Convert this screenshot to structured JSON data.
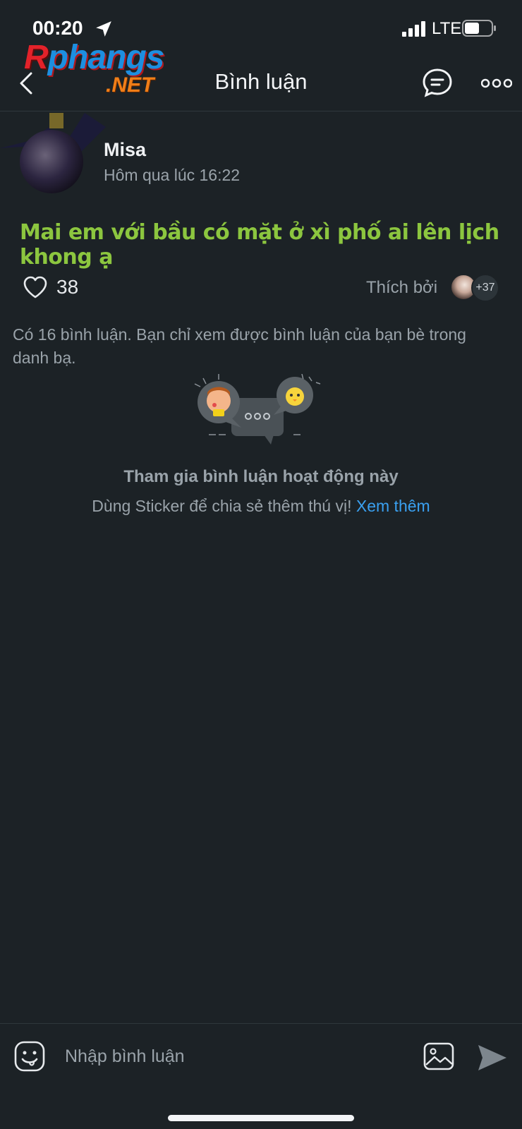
{
  "status_bar": {
    "time": "00:20",
    "network": "LTE",
    "icons": [
      "location-arrow-icon",
      "signal-bars-icon",
      "battery-icon"
    ]
  },
  "watermark": {
    "brand_letter": "R",
    "brand_rest": "phangs",
    "brand_sub": ".NET"
  },
  "header": {
    "title": "Bình luận",
    "icons": [
      "back-chevron-icon",
      "chat-bubble-icon",
      "more-dots-icon"
    ]
  },
  "post": {
    "author": "Misa",
    "time": "Hôm qua lúc 16:22",
    "text": "Mai em với bầu có mặt ở xì phố ai lên lịch khong ạ",
    "text_color": "#8cc63f",
    "likes": "38",
    "liked_by_label": "Thích bởi",
    "liked_by_more": "+37"
  },
  "comments": {
    "info": "Có 16 bình luận. Bạn chỉ xem được bình luận của bạn bè trong danh bạ.",
    "empty_title": "Tham gia bình luận hoạt động này",
    "empty_sub": "Dùng Sticker để chia sẻ thêm thú vị!",
    "empty_link": "Xem thêm",
    "link_color": "#3aa0f0"
  },
  "input_bar": {
    "placeholder": "Nhập bình luận",
    "icons": [
      "sticker-icon",
      "image-icon",
      "send-icon"
    ]
  },
  "colors": {
    "background": "#1c2226",
    "muted_text": "#9aa3aa"
  }
}
